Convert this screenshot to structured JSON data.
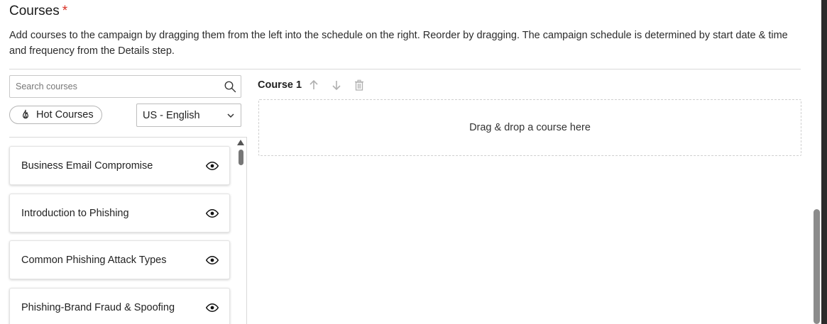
{
  "section": {
    "title": "Courses",
    "required_marker": "*",
    "description": "Add courses to the campaign by dragging them from the left into the schedule on the right. Reorder by dragging. The campaign schedule is determined by start date & time and frequency from the Details step."
  },
  "search": {
    "placeholder": "Search courses",
    "value": "",
    "icon": "search-icon"
  },
  "filters": {
    "hot_courses_label": "Hot Courses",
    "hot_courses_icon": "flame-icon",
    "language_selected": "US - English"
  },
  "courses": [
    {
      "name": "Business Email Compromise"
    },
    {
      "name": "Introduction to Phishing"
    },
    {
      "name": "Common Phishing Attack Types"
    },
    {
      "name": "Phishing-Brand Fraud & Spoofing"
    }
  ],
  "schedule": {
    "course_label": "Course 1",
    "dropzone_text": "Drag & drop a course here"
  },
  "colors": {
    "required": "#d93025",
    "border": "#d9d9d9",
    "control_disabled": "#b0b0b0"
  }
}
